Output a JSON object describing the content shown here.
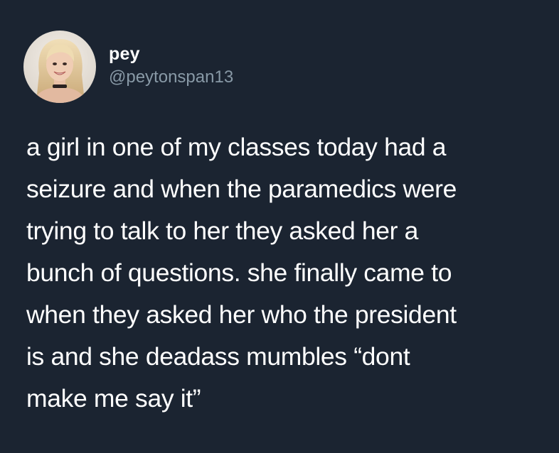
{
  "tweet": {
    "author": {
      "display_name": "pey",
      "handle": "@peytonspan13",
      "avatar_icon": "profile-photo"
    },
    "text_lines": [
      "a girl in one of my classes today had a",
      "seizure and when the paramedics were",
      "trying to talk to her they asked her a",
      "bunch of questions. she finally came to",
      "when they asked her who the president",
      "is and she deadass mumbles “dont",
      "make me say it”"
    ]
  },
  "colors": {
    "background": "#1b2431",
    "text": "#ffffff",
    "handle": "#8899a6"
  }
}
